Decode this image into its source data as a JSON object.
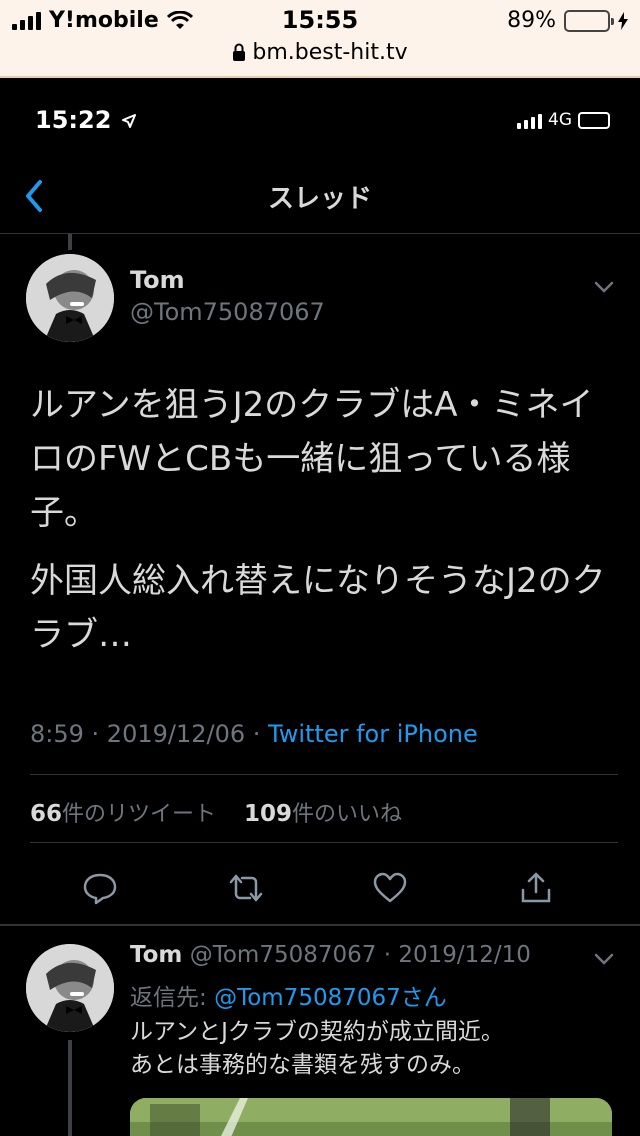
{
  "outer_status": {
    "carrier": "Y!mobile",
    "time": "15:55",
    "battery": "89%",
    "battery_level": 0.89,
    "url": "bm.best-hit.tv"
  },
  "inner_status": {
    "time": "15:22",
    "network": "4G"
  },
  "header": {
    "title": "スレッド"
  },
  "tweet": {
    "name": "Tom",
    "handle": "@Tom75087067",
    "paragraph1": "ルアンを狙うJ2のクラブはA・ミネイロのFWとCBも一緒に狙っている様子。",
    "paragraph2": "外国人総入れ替えになりそうなJ2のクラブ…",
    "time": "8:59",
    "date": "2019/12/06",
    "source": "Twitter for iPhone",
    "retweet_count": "66",
    "retweet_label": "件のリツイート",
    "like_count": "109",
    "like_label": "件のいいね"
  },
  "reply": {
    "name": "Tom",
    "handle": "@Tom75087067",
    "date": "2019/12/10",
    "reply_to_label": "返信先:",
    "reply_to_handle": "@Tom75087067さん",
    "line1": "ルアンとJクラブの契約が成立間近。",
    "line2": "あとは事務的な書類を残すのみ。"
  },
  "colors": {
    "accent": "#1d9bf0",
    "muted": "#6e767d",
    "text": "#d9d9d9",
    "background": "#000000"
  }
}
